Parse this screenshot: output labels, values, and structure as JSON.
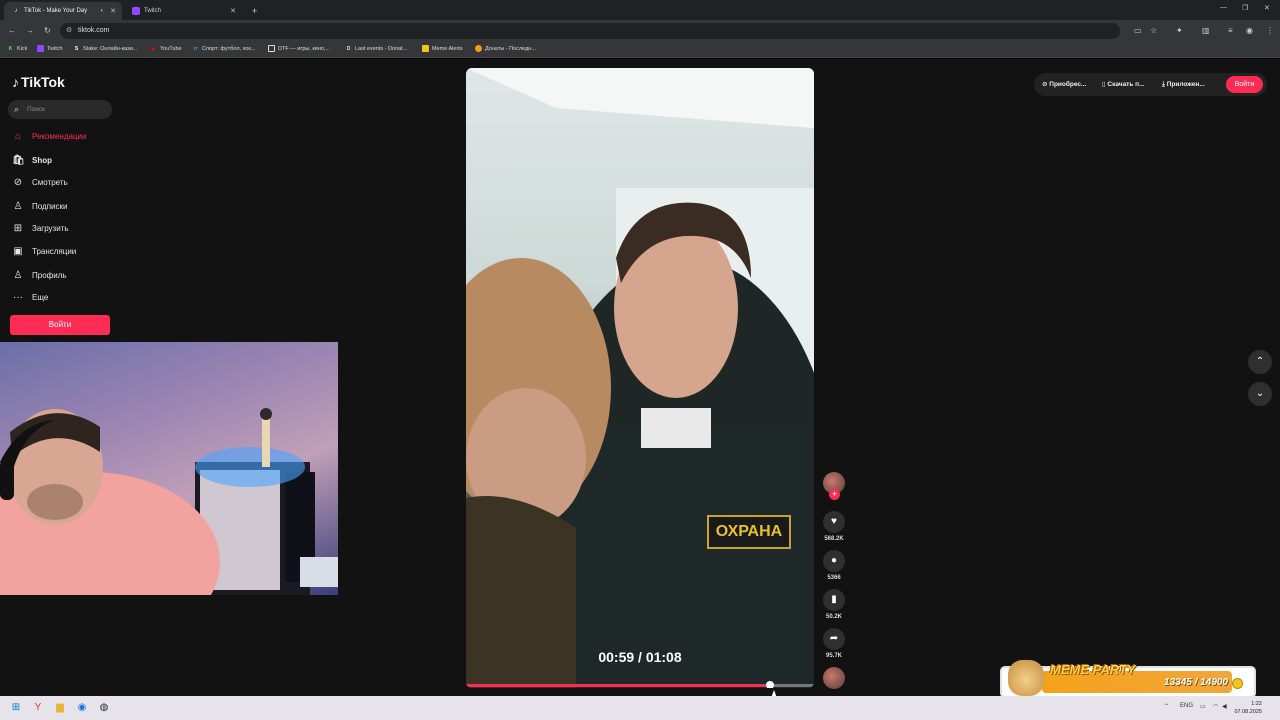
{
  "browser": {
    "tabs": [
      {
        "label": "TikTok - Make Your Day",
        "active": true,
        "icon": "tiktok-icon"
      },
      {
        "label": "Twitch",
        "active": false,
        "icon": "twitch-icon"
      }
    ],
    "new_tab": "+",
    "url": "tiktok.com",
    "bookmarks": [
      {
        "label": "Kick",
        "icon": "kick-icon",
        "color": "#53fc18"
      },
      {
        "label": "Twitch",
        "icon": "twitch-icon",
        "color": "#9146ff"
      },
      {
        "label": "Stake: Онлайн-кази...",
        "icon": "stake-icon",
        "color": "#ffffff"
      },
      {
        "label": "YouTube",
        "icon": "youtube-icon",
        "color": "#ff0000"
      },
      {
        "label": "Спорт: футбол, хок...",
        "icon": "sport-icon",
        "color": "#3aa0ff"
      },
      {
        "label": "DTF — игры, кино,...",
        "icon": "dtf-icon",
        "color": "#ffffff"
      },
      {
        "label": "Last events - Donat...",
        "icon": "donat-icon",
        "color": "#dddddd"
      },
      {
        "label": "Meme Alerts",
        "icon": "memealerts-icon",
        "color": "#f5c518"
      },
      {
        "label": "Донаты - Последн...",
        "icon": "donations-icon",
        "color": "#f59e0b"
      }
    ]
  },
  "sidebar": {
    "logo": "TikTok",
    "search_placeholder": "Поиск",
    "items": [
      {
        "label": "Рекомендации",
        "icon": "home-icon",
        "active": true
      },
      {
        "label": "Shop",
        "icon": "shop-icon",
        "active": false
      },
      {
        "label": "Смотреть",
        "icon": "compass-icon",
        "active": false
      },
      {
        "label": "Подписки",
        "icon": "following-icon",
        "active": false
      },
      {
        "label": "Загрузить",
        "icon": "upload-icon",
        "active": false
      },
      {
        "label": "Трансляции",
        "icon": "live-icon",
        "active": false
      },
      {
        "label": "Профиль",
        "icon": "profile-icon",
        "active": false
      },
      {
        "label": "Еще",
        "icon": "more-icon",
        "active": false
      }
    ],
    "login": "Войти"
  },
  "header": {
    "buttons": [
      {
        "label": "Приобрес...",
        "icon": "coin-icon"
      },
      {
        "label": "Скачать п...",
        "icon": "phone-icon"
      },
      {
        "label": "Приложен...",
        "icon": "download-icon"
      }
    ],
    "login": "Войти"
  },
  "video": {
    "patch_text": "ОХРАНА",
    "time": "00:59 / 01:08",
    "progress": 0.874
  },
  "actions": {
    "likes": "568.2K",
    "comments": "5366",
    "saves": "50.2K",
    "shares": "95.7K"
  },
  "overlay": {
    "title": "MEME PARTY",
    "score": "13345 / 14900",
    "progress": 0.896
  },
  "taskbar": {
    "lang": "ENG",
    "time": "1:22",
    "date": "07.08.2025"
  },
  "colors": {
    "accent": "#fe2c55",
    "background": "#121212"
  }
}
